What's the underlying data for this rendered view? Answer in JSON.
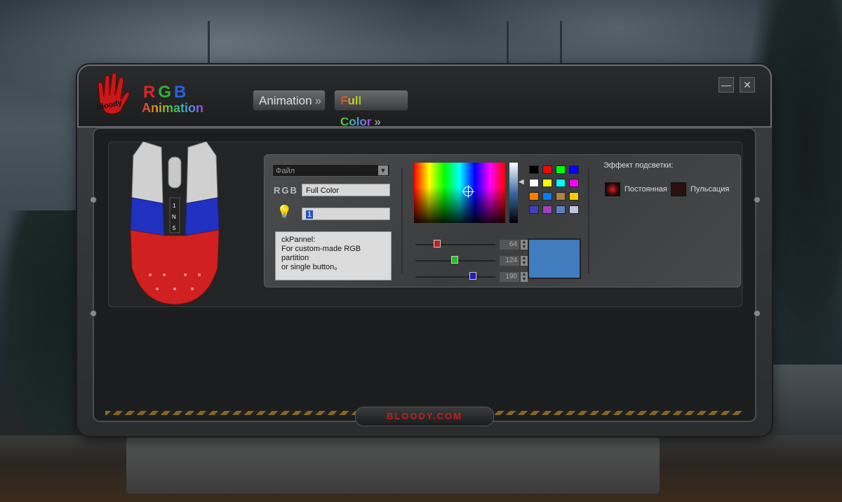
{
  "app": {
    "brand_rgb": [
      "R",
      "G",
      "B"
    ],
    "brand_animation": "Animation",
    "logo_text": "bloody"
  },
  "tabs": [
    {
      "label": "Animation",
      "chevrons": "»"
    },
    {
      "label": "Full Color",
      "chevrons": "»"
    }
  ],
  "window_controls": {
    "minimize": "—",
    "close": "✕"
  },
  "file_panel": {
    "file_select_label": "Файл",
    "rgb_label": "RGB",
    "name_value": "Full Color",
    "number_value": "1",
    "description_lines": [
      "ckPannel:",
      "For custom-made RGB partition",
      "or single button。"
    ]
  },
  "color_picker": {
    "swatches": [
      "#000000",
      "#ff0000",
      "#00ff00",
      "#0000ff",
      "#ffffff",
      "#ffff00",
      "#00ffff",
      "#ff00ff",
      "#ff8000",
      "#0080ff",
      "#b08040",
      "#ffcc00",
      "#4040c0",
      "#a040c0",
      "#6080c0",
      "#c0c0e0"
    ],
    "red": 64,
    "green": 124,
    "blue": 190,
    "preview_color": "#407cbe"
  },
  "effects": {
    "title": "Эффект подсветки:",
    "options": [
      "Постоянная",
      "Пульсация"
    ]
  },
  "footer": {
    "site": "BLOODY.COM"
  },
  "mouse_zones": {
    "top_color": "#d0d0d0",
    "middle_color": "#2030c0",
    "bottom_color": "#d02020",
    "button_labels": [
      "1",
      "N",
      "5"
    ]
  }
}
